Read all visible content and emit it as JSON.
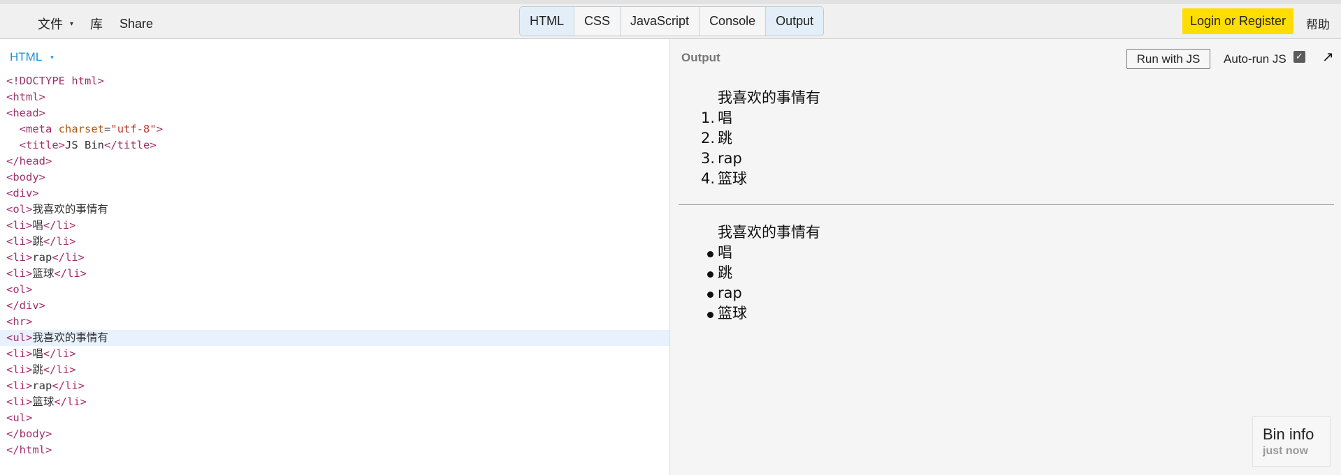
{
  "topbar": {
    "menu": [
      {
        "label": "文件",
        "caret": "▾"
      },
      {
        "label": "库"
      },
      {
        "label": "Share"
      }
    ],
    "panels": [
      {
        "label": "HTML",
        "active": true
      },
      {
        "label": "CSS",
        "active": false
      },
      {
        "label": "JavaScript",
        "active": false
      },
      {
        "label": "Console",
        "active": false
      },
      {
        "label": "Output",
        "active": true
      }
    ],
    "login_label": "Login or Register",
    "help_label": "帮助"
  },
  "editor": {
    "language_label": "HTML",
    "caret": "▾",
    "highlighted_line": 16
  },
  "output": {
    "label": "Output",
    "run_label": "Run with JS",
    "autorun_label": "Auto-run JS",
    "autorun_checked": true,
    "popout_icon": "↗",
    "ordered_list": {
      "header": "我喜欢的事情有",
      "markers": [
        "1.",
        "2.",
        "3.",
        "4."
      ],
      "items": [
        "唱",
        "跳",
        "rap",
        "篮球"
      ]
    },
    "unordered_list": {
      "header": "我喜欢的事情有",
      "items": [
        "唱",
        "跳",
        "rap",
        "篮球"
      ]
    },
    "bin_info": {
      "title": "Bin info",
      "subtitle": "just now"
    }
  },
  "colors": {
    "login_bg": "#fedd00",
    "active_tab_bg": "#e4eef8",
    "editor_label": "#1e90d6",
    "highlight_line": "#e8f2fe"
  }
}
